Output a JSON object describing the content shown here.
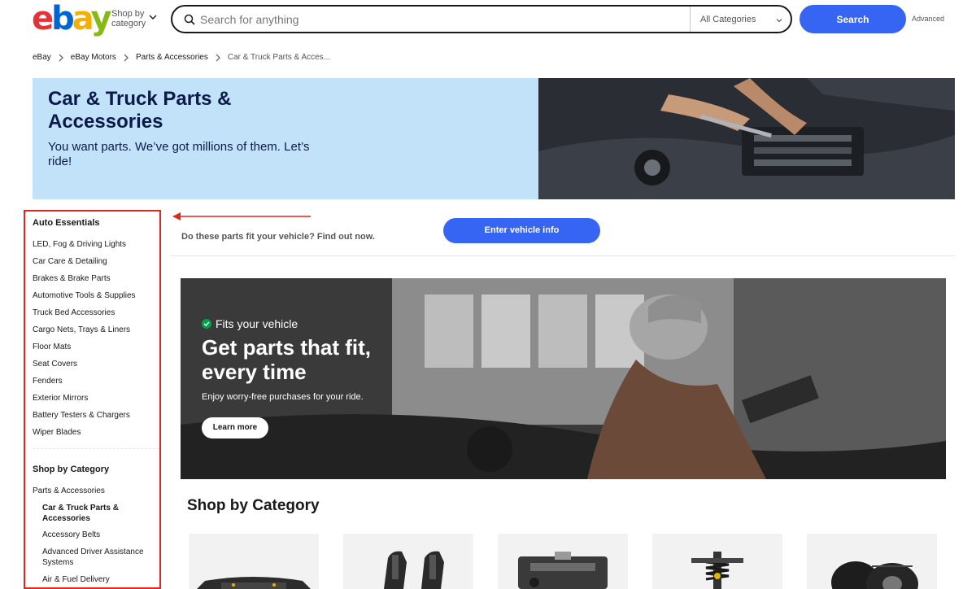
{
  "header": {
    "logo_alt": "ebay",
    "shop_by_category": "Shop by category",
    "search_placeholder": "Search for anything",
    "category_select": "All Categories",
    "search_button": "Search",
    "advanced_link": "Advanced"
  },
  "breadcrumb": [
    "eBay",
    "eBay Motors",
    "Parts & Accessories",
    "Car & Truck Parts & Acces..."
  ],
  "hero": {
    "title": "Car & Truck Parts & Accessories",
    "subtitle": "You want parts. We’ve got millions of them. Let’s ride!"
  },
  "sidebar": {
    "section1_title": "Auto Essentials",
    "section1_items": [
      "LED, Fog & Driving Lights",
      "Car Care & Detailing",
      "Brakes & Brake Parts",
      "Automotive Tools & Supplies",
      "Truck Bed Accessories",
      "Cargo Nets, Trays & Liners",
      "Floor Mats",
      "Seat Covers",
      "Fenders",
      "Exterior Mirrors",
      "Battery Testers & Chargers",
      "Wiper Blades"
    ],
    "section2_title": "Shop by Category",
    "section2_parent": "Parts & Accessories",
    "section2_items": [
      "Car & Truck Parts & Accessories",
      "Accessory Belts",
      "Advanced Driver Assistance Systems",
      "Air & Fuel Delivery"
    ]
  },
  "fit": {
    "question": "Do these parts fit your vehicle? Find out now.",
    "button": "Enter vehicle info"
  },
  "promo": {
    "badge": "Fits your vehicle",
    "title": "Get parts that fit, every time",
    "subtitle": "Enjoy worry-free purchases for your ride.",
    "button": "Learn more"
  },
  "shop_by_category_title": "Shop by Category",
  "colors": {
    "accent_blue": "#3665f3",
    "hero_bg": "#c2e2f9",
    "highlight_red": "#e0261d",
    "check_green": "#05a04a"
  }
}
